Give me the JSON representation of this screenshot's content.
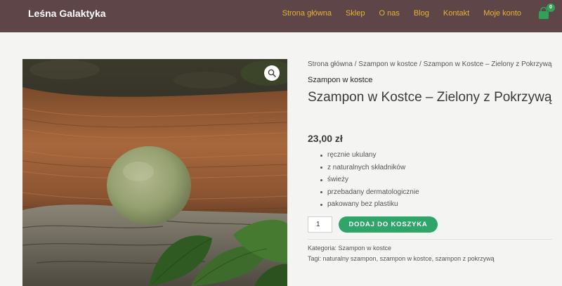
{
  "site": {
    "brand": "Leśna Galaktyka"
  },
  "nav": {
    "items": [
      {
        "label": "Strona główna"
      },
      {
        "label": "Sklep"
      },
      {
        "label": "O nas"
      },
      {
        "label": "Blog"
      },
      {
        "label": "Kontakt"
      },
      {
        "label": "Moje konto"
      }
    ]
  },
  "cart": {
    "count": "0"
  },
  "product": {
    "breadcrumb": {
      "home": "Strona główna",
      "sep1": " / ",
      "category": "Szampon w kostce",
      "sep2": " / ",
      "current": "Szampon w Kostce – Zielony z Pokrzywą"
    },
    "category_label": "Szampon w kostce",
    "title": "Szampon w Kostce – Zielony z Pokrzywą",
    "price": "23,00 zł",
    "features": [
      "ręcznie ukulany",
      "z naturalnych składników",
      "świeży",
      "przebadany dermatologicznie",
      "pakowany bez plastiku"
    ],
    "quantity": "1",
    "add_to_cart_label": "DODAJ DO KOSZYKA",
    "meta": {
      "category_prefix": "Kategoria: ",
      "category": "Szampon w kostce",
      "tags_prefix": "Tagi: ",
      "tags": [
        {
          "label": "naturalny szampon",
          "sep": ", "
        },
        {
          "label": "szampon w kostce",
          "sep": ", "
        },
        {
          "label": "szampon z pokrzywą",
          "sep": ""
        }
      ]
    }
  },
  "colors": {
    "header_bg": "#5e4548",
    "nav_link": "#e2b438",
    "accent_green": "#2fa56a",
    "page_bg": "#f4f5f3"
  },
  "icons": [
    "cart-icon",
    "search-zoom-icon"
  ]
}
